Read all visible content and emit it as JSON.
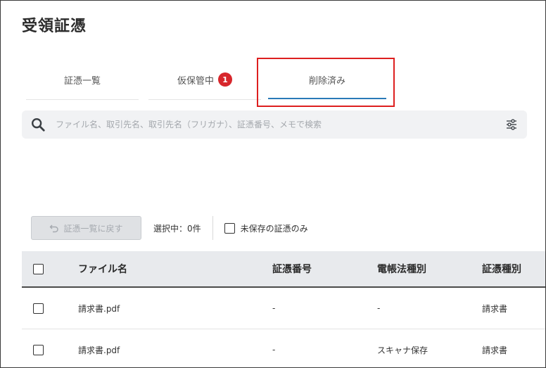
{
  "page": {
    "title": "受領証憑"
  },
  "tabs": [
    {
      "label": "証憑一覧",
      "active": false
    },
    {
      "label": "仮保管中",
      "active": false,
      "badge": "1"
    },
    {
      "label": "削除済み",
      "active": true
    }
  ],
  "search": {
    "placeholder": "ファイル名、取引先名、取引先名（フリガナ）、証憑番号、メモで検索",
    "value": "",
    "icon": "search-icon",
    "filter_icon": "sliders-icon"
  },
  "toolbar": {
    "back_label": "証憑一覧に戻す",
    "back_icon": "undo-icon",
    "selected_text": "選択中：0件",
    "unsaved_only_label": "未保存の証憑のみ",
    "unsaved_only_checked": false
  },
  "table": {
    "columns": [
      "ファイル名",
      "証憑番号",
      "電帳法種別",
      "証憑種別"
    ],
    "rows": [
      {
        "file": "請求書.pdf",
        "number": "-",
        "type": "-",
        "kind": "請求書"
      },
      {
        "file": "請求書.pdf",
        "number": "-",
        "type": "スキャナ保存",
        "kind": "請求書"
      }
    ]
  },
  "colors": {
    "accent": "#2a7ab8",
    "badge": "#d7262b",
    "highlight": "#dd1f1f",
    "header_bg": "#e8eaed",
    "search_bg": "#f1f2f4"
  }
}
